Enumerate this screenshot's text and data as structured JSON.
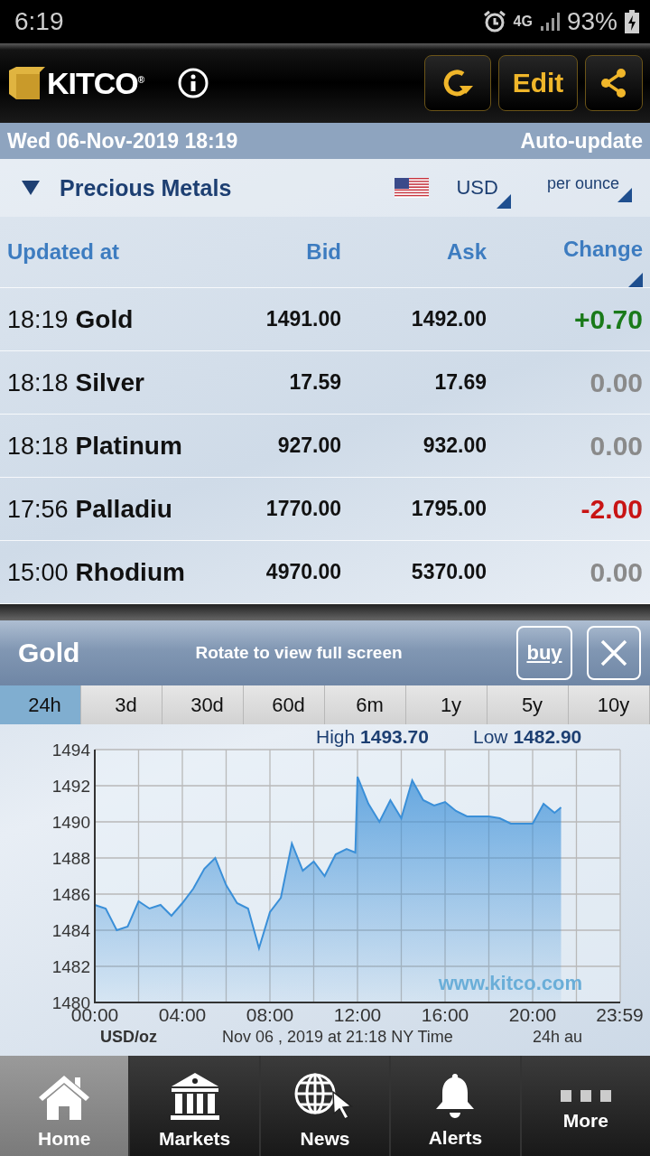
{
  "status_bar": {
    "time": "6:19",
    "network": "4G",
    "battery": "93%"
  },
  "header": {
    "logo": "KITCO$^{®}$",
    "edit": "Edit"
  },
  "date_bar": {
    "datetime": "Wed 06-Nov-2019 18:19",
    "auto_update": "Auto-update"
  },
  "section": {
    "title": "Precious Metals",
    "expanded": true,
    "currency": "USD",
    "unit": "per ounce"
  },
  "table": {
    "columns": [
      "Updated at",
      "Bid",
      "Ask",
      "Change"
    ],
    "rows": [
      {
        "time": "18:19",
        "name": "Gold",
        "bid": "1491.00",
        "ask": "1492.00",
        "change": "+0.70",
        "color": "#1a7a1a"
      },
      {
        "time": "18:18",
        "name": "Silver",
        "bid": "17.59",
        "ask": "17.69",
        "change": "0.00",
        "color": "#8a8a8a"
      },
      {
        "time": "18:18",
        "name": "Platinum",
        "bid": "927.00",
        "ask": "932.00",
        "change": "0.00",
        "color": "#8a8a8a"
      },
      {
        "time": "17:56",
        "name": "Palladiu",
        "bid": "1770.00",
        "ask": "1795.00",
        "change": "-2.00",
        "color": "#c81414"
      },
      {
        "time": "15:00",
        "name": "Rhodium",
        "bid": "4970.00",
        "ask": "5370.00",
        "change": "0.00",
        "color": "#8a8a8a"
      }
    ]
  },
  "chart_panel": {
    "title": "Gold",
    "hint": "Rotate to view full screen",
    "buy": "buy",
    "periods": [
      {
        "label": "24h",
        "selected": true
      },
      {
        "label": "3d",
        "selected": false
      },
      {
        "label": "30d",
        "selected": false
      },
      {
        "label": "60d",
        "selected": false
      },
      {
        "label": "6m",
        "selected": false
      },
      {
        "label": "1y",
        "selected": false
      },
      {
        "label": "5y",
        "selected": false
      },
      {
        "label": "10y",
        "selected": false
      }
    ],
    "high_label": "High",
    "high": "1493.70",
    "low_label": "Low",
    "low": "1482.90",
    "watermark": "www.kitco.com",
    "unit": "USD/oz",
    "timestamp": "Nov 06 , 2019 at 21:18 NY Time",
    "range_note": "24h au",
    "chart_data": {
      "type": "area",
      "x": [
        0,
        0.5,
        1,
        1.5,
        2,
        2.5,
        3,
        3.5,
        4,
        4.5,
        5,
        5.5,
        6,
        6.5,
        7,
        7.5,
        8,
        8.5,
        9,
        9.5,
        10,
        10.5,
        11,
        11.5,
        11.9,
        12,
        12.5,
        13,
        13.5,
        14,
        14.5,
        15,
        15.5,
        16,
        16.5,
        17,
        17.5,
        18,
        18.5,
        19,
        19.5,
        20,
        20.5,
        21,
        21.3
      ],
      "series": [
        {
          "color": "#3a8fd8",
          "values": [
            1485.4,
            1485.2,
            1484.0,
            1484.2,
            1485.6,
            1485.2,
            1485.4,
            1484.8,
            1485.5,
            1486.3,
            1487.4,
            1488.0,
            1486.5,
            1485.5,
            1485.2,
            1483.0,
            1485.0,
            1485.8,
            1488.8,
            1487.3,
            1487.8,
            1487.0,
            1488.2,
            1488.5,
            1488.3,
            1492.5,
            1491.0,
            1490.0,
            1491.2,
            1490.2,
            1492.3,
            1491.2,
            1490.9,
            1491.1,
            1490.6,
            1490.3,
            1490.3,
            1490.3,
            1490.2,
            1489.9,
            1489.9,
            1489.9,
            1491.0,
            1490.5,
            1490.8
          ]
        }
      ],
      "xlim": [
        0,
        24
      ],
      "ylim": [
        1480,
        1494
      ],
      "xticks": [
        {
          "value": 0,
          "label": "00:00"
        },
        {
          "value": 4,
          "label": "04:00"
        },
        {
          "value": 8,
          "label": "08:00"
        },
        {
          "value": 12,
          "label": "12:00"
        },
        {
          "value": 16,
          "label": "16:00"
        },
        {
          "value": 20,
          "label": "20:00"
        },
        {
          "value": 23.98,
          "label": "23:59"
        }
      ],
      "grid": true,
      "yticks": [
        1480,
        1482,
        1484,
        1486,
        1488,
        1490,
        1492,
        1494
      ]
    }
  },
  "nav": {
    "items": [
      {
        "label": "Home",
        "kind": "home",
        "selected": true
      },
      {
        "label": "Markets",
        "kind": "bank",
        "selected": false
      },
      {
        "label": "News",
        "kind": "globe",
        "selected": false
      },
      {
        "label": "Alerts",
        "kind": "bell",
        "selected": false
      },
      {
        "label": "More",
        "kind": "dots",
        "selected": false
      }
    ]
  }
}
